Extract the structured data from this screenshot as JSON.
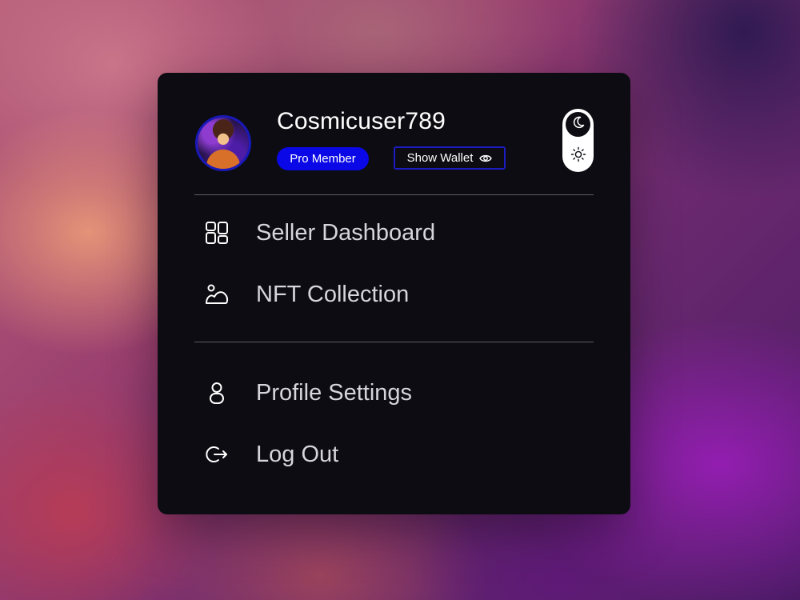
{
  "profile": {
    "username": "Cosmicuser789",
    "membership_badge": "Pro Member",
    "wallet_button_label": "Show Wallet",
    "avatar_icon": "user-avatar-portrait"
  },
  "theme_toggle": {
    "active_mode": "dark",
    "dark_icon": "moon-icon",
    "light_icon": "sun-icon"
  },
  "menu": {
    "primary": [
      {
        "label": "Seller Dashboard",
        "icon": "dashboard-grid-icon"
      },
      {
        "label": "NFT Collection",
        "icon": "image-landscape-icon"
      }
    ],
    "secondary": [
      {
        "label": "Profile Settings",
        "icon": "user-icon"
      },
      {
        "label": "Log Out",
        "icon": "logout-icon"
      }
    ]
  },
  "colors": {
    "card_background": "#0c0c12",
    "accent_blue": "#0a08e6",
    "text_primary": "#ffffff",
    "text_menu": "#d5d5db",
    "divider": "#5d5d66"
  }
}
